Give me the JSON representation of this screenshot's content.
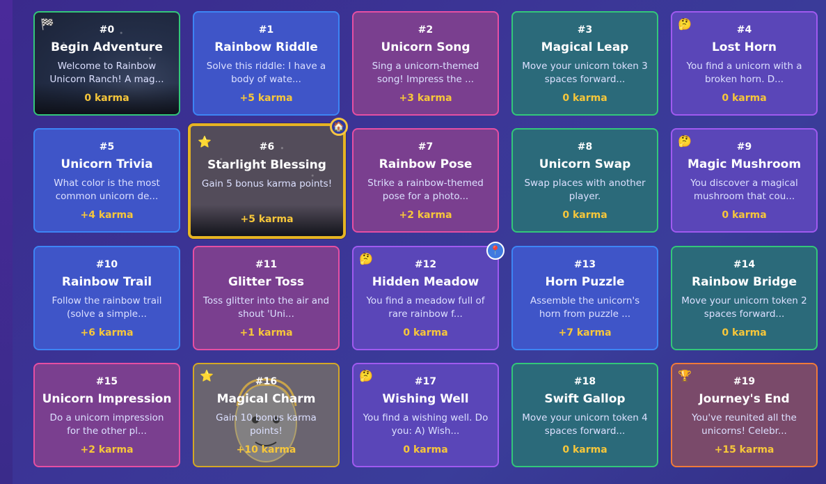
{
  "tiles": [
    {
      "num": "#0",
      "title": "Begin Adventure",
      "desc": "Welcome to Rainbow Unicorn Ranch! A mag...",
      "karma": "0 karma",
      "color": "green",
      "icon": "checkered-flag-icon",
      "glyph": "🏁",
      "sky": true
    },
    {
      "num": "#1",
      "title": "Rainbow Riddle",
      "desc": "Solve this riddle: I have a body of wate...",
      "karma": "+5 karma",
      "color": "blue",
      "icon": "",
      "glyph": ""
    },
    {
      "num": "#2",
      "title": "Unicorn Song",
      "desc": "Sing a unicorn-themed song! Impress the ...",
      "karma": "+3 karma",
      "color": "pink",
      "icon": "",
      "glyph": ""
    },
    {
      "num": "#3",
      "title": "Magical Leap",
      "desc": "Move your unicorn token 3 spaces forward...",
      "karma": "0 karma",
      "color": "green",
      "icon": "",
      "glyph": ""
    },
    {
      "num": "#4",
      "title": "Lost Horn",
      "desc": "You find a unicorn with a broken horn. D...",
      "karma": "0 karma",
      "color": "purple",
      "icon": "thinking-face-icon",
      "glyph": "🤔"
    },
    {
      "num": "#5",
      "title": "Unicorn Trivia",
      "desc": "What color is the most common unicorn de...",
      "karma": "+4 karma",
      "color": "blue",
      "icon": "",
      "glyph": ""
    },
    {
      "num": "#6",
      "title": "Starlight Blessing",
      "desc": "Gain 5 bonus karma points!",
      "karma": "+5 karma",
      "color": "active",
      "icon": "star-icon",
      "glyph": "⭐",
      "sky": true
    },
    {
      "num": "#7",
      "title": "Rainbow Pose",
      "desc": "Strike a rainbow-themed pose for a photo...",
      "karma": "+2 karma",
      "color": "pink",
      "icon": "",
      "glyph": ""
    },
    {
      "num": "#8",
      "title": "Unicorn Swap",
      "desc": "Swap places with another player.",
      "karma": "0 karma",
      "color": "green",
      "icon": "",
      "glyph": ""
    },
    {
      "num": "#9",
      "title": "Magic Mushroom",
      "desc": "You discover a magical mushroom that cou...",
      "karma": "0 karma",
      "color": "purple",
      "icon": "thinking-face-icon",
      "glyph": "🤔"
    },
    {
      "num": "#10",
      "title": "Rainbow Trail",
      "desc": "Follow the rainbow trail (solve a simple...",
      "karma": "+6 karma",
      "color": "blue",
      "icon": "",
      "glyph": ""
    },
    {
      "num": "#11",
      "title": "Glitter Toss",
      "desc": "Toss glitter into the air and shout 'Uni...",
      "karma": "+1 karma",
      "color": "pink",
      "icon": "",
      "glyph": ""
    },
    {
      "num": "#12",
      "title": "Hidden Meadow",
      "desc": "You find a meadow full of rare rainbow f...",
      "karma": "0 karma",
      "color": "purple",
      "icon": "thinking-face-icon",
      "glyph": "🤔"
    },
    {
      "num": "#13",
      "title": "Horn Puzzle",
      "desc": "Assemble the unicorn's horn from puzzle ...",
      "karma": "+7 karma",
      "color": "blue",
      "icon": "",
      "glyph": ""
    },
    {
      "num": "#14",
      "title": "Rainbow Bridge",
      "desc": "Move your unicorn token 2 spaces forward...",
      "karma": "0 karma",
      "color": "green",
      "icon": "",
      "glyph": ""
    },
    {
      "num": "#15",
      "title": "Unicorn Impression",
      "desc": "Do a unicorn impression for the other pl...",
      "karma": "+2 karma",
      "color": "pink",
      "icon": "",
      "glyph": ""
    },
    {
      "num": "#16",
      "title": "Magical Charm",
      "desc": "Gain 10 bonus karma points!",
      "karma": "+10 karma",
      "color": "gold",
      "icon": "star-icon",
      "glyph": "⭐",
      "face": true
    },
    {
      "num": "#17",
      "title": "Wishing Well",
      "desc": "You find a wishing well. Do you: A) Wish...",
      "karma": "0 karma",
      "color": "purple",
      "icon": "thinking-face-icon",
      "glyph": "🤔"
    },
    {
      "num": "#18",
      "title": "Swift Gallop",
      "desc": "Move your unicorn token 4 spaces forward...",
      "karma": "0 karma",
      "color": "green",
      "icon": "",
      "glyph": ""
    },
    {
      "num": "#19",
      "title": "Journey's End",
      "desc": "You've reunited all the unicorns! Celebr...",
      "karma": "+15 karma",
      "color": "orange",
      "icon": "trophy-icon",
      "glyph": "🏆"
    }
  ],
  "markers": {
    "house": {
      "glyph": "🏠",
      "icon": "house-marker-icon"
    },
    "pin": {
      "glyph": "📍",
      "icon": "player-pin-icon"
    }
  }
}
